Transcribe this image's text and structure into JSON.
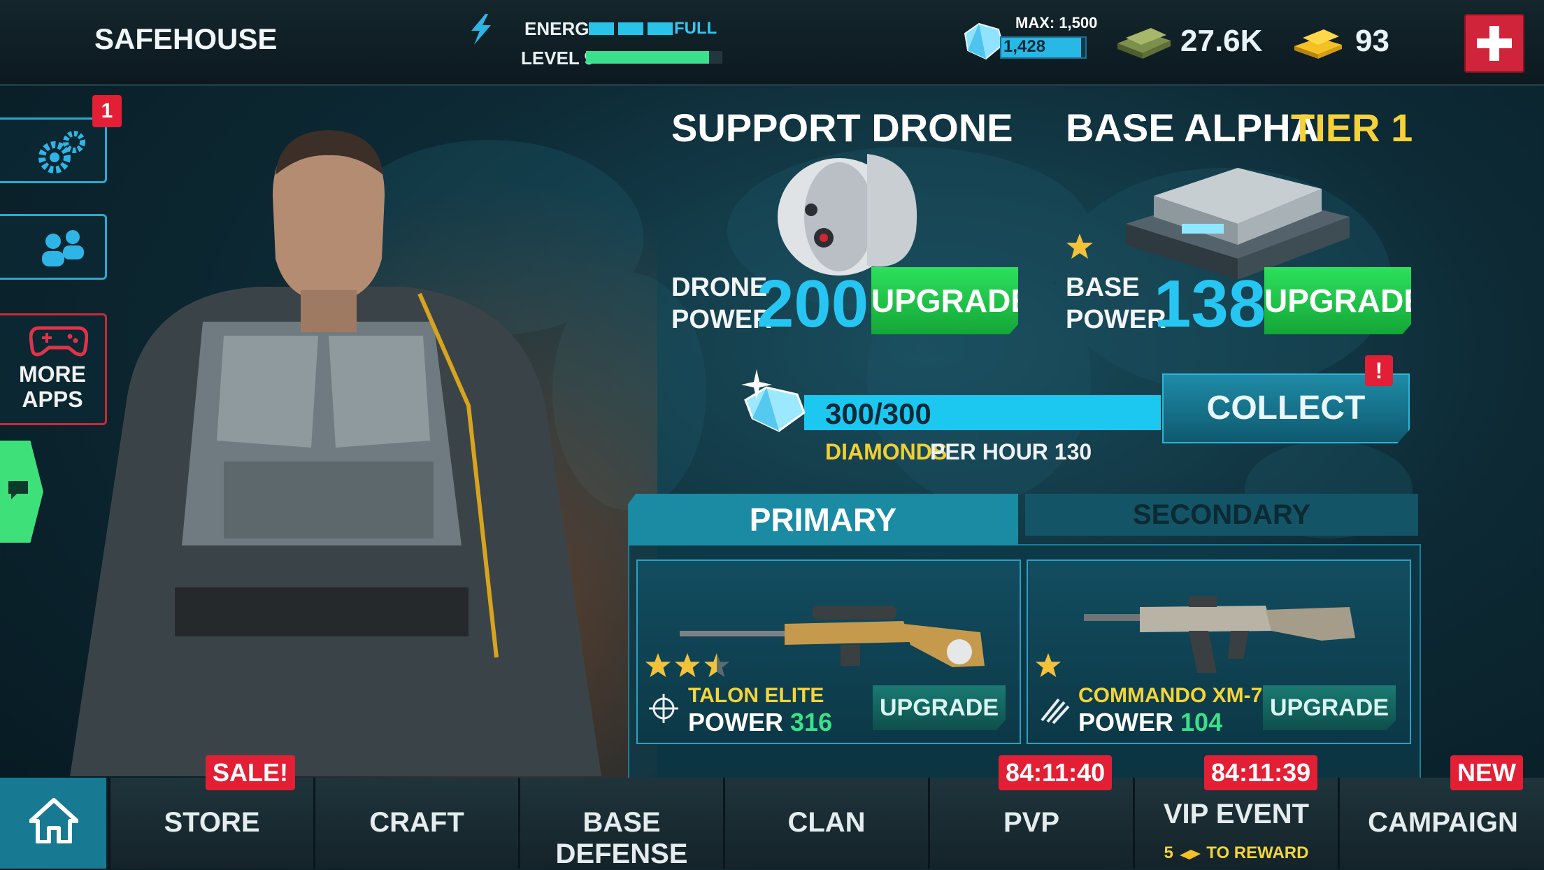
{
  "header": {
    "title": "SAFEHOUSE",
    "energy_label": "ENERGY",
    "energy_status": "FULL",
    "energy_segments": 3,
    "level_label": "LEVEL 9",
    "level_progress": 0.9
  },
  "currencies": {
    "diamond_max": "MAX: 1,500",
    "diamond_count": "1,428",
    "diamond_fill": 0.95,
    "cash": "27.6K",
    "gold": "93"
  },
  "sidebar": {
    "settings_badge": "1",
    "more_apps": "MORE APPS"
  },
  "drone": {
    "title": "SUPPORT DRONE",
    "power_label_1": "DRONE",
    "power_label_2": "POWER",
    "power": "200",
    "upgrade": "UPGRADE"
  },
  "base": {
    "title": "BASE ALPHA",
    "tier": "TIER 1",
    "stars": 1,
    "power_label_1": "BASE",
    "power_label_2": "POWER",
    "power": "138",
    "upgrade": "UPGRADE"
  },
  "production": {
    "value": "300/300",
    "fill": 1.0,
    "diamonds_label": "DIAMONDS",
    "per_hour": "PER HOUR 130",
    "collect": "COLLECT",
    "alert": "!"
  },
  "weapons": {
    "tab_primary": "PRIMARY",
    "tab_secondary": "SECONDARY",
    "primary": {
      "name": "TALON ELITE",
      "power_label": "POWER",
      "power": "316",
      "stars": 2.5,
      "upgrade": "UPGRADE"
    },
    "secondary": {
      "name": "COMMANDO XM-7",
      "power_label": "POWER",
      "power": "104",
      "stars": 1,
      "upgrade": "UPGRADE"
    }
  },
  "nav": {
    "store": "STORE",
    "store_badge": "SALE!",
    "craft": "CRAFT",
    "base_defense": "BASE DEFENSE",
    "clan": "CLAN",
    "pvp": "PVP",
    "pvp_timer": "84:11:40",
    "vip_event": "VIP EVENT",
    "vip_timer": "84:11:39",
    "vip_reward_count": "5",
    "vip_reward_text": "TO REWARD",
    "campaign": "CAMPAIGN",
    "campaign_badge": "NEW"
  },
  "colors": {
    "accent": "#27c6f2",
    "upgrade_green": "#2de05d",
    "alert_red": "#e21f34",
    "gold_text": "#f3d53a"
  }
}
